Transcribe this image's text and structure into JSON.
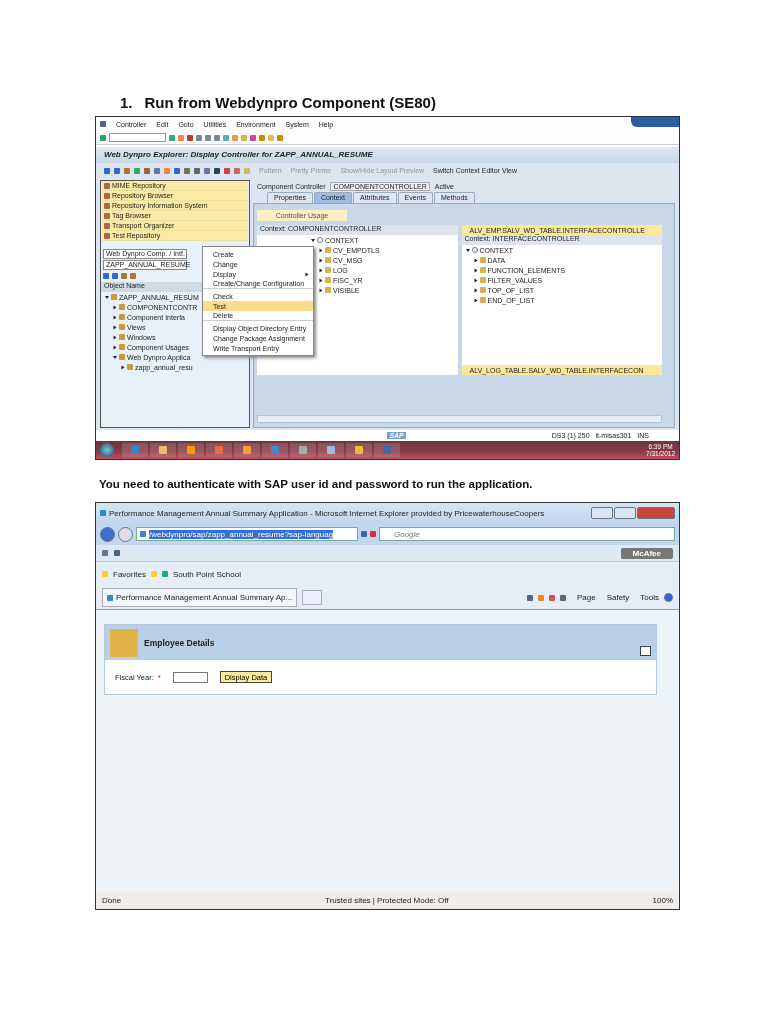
{
  "heading": {
    "number": "1.",
    "text": "Run from Webdynpro Component (SE80)"
  },
  "sap": {
    "menu": [
      "Controller",
      "Edit",
      "Goto",
      "Utilities",
      "Environment",
      "System",
      "Help"
    ],
    "title": "Web Dynpro Explorer: Display Controller for ZAPP_ANNUAL_RESUME",
    "app_toolbar": [
      "Pattern",
      "Pretty Printer",
      "Show/Hide Layout Preview",
      "Switch Context Editor View"
    ],
    "nav_items": [
      "MIME Repository",
      "Repository Browser",
      "Repository Information System",
      "Tag Browser",
      "Transport Organizer",
      "Test Repository"
    ],
    "object_type": "Web Dynpro Comp. / Intf.",
    "object_name": "ZAPP_ANNUAL_RESUME",
    "object_header": "Object Name",
    "tree": [
      {
        "label": "ZAPP_ANNUAL_RESUM",
        "expanded": true,
        "children": [
          {
            "label": "COMPONENTCONTR",
            "expanded": false
          },
          {
            "label": "Component Interfa",
            "expanded": false
          },
          {
            "label": "Views",
            "expanded": false
          },
          {
            "label": "Windows",
            "expanded": false
          },
          {
            "label": "Component Usages",
            "expanded": false
          },
          {
            "label": "Web Dynpro Applica",
            "expanded": true,
            "children": [
              {
                "label": "zapp_annual_resu",
                "expanded": false
              }
            ]
          }
        ]
      }
    ],
    "controller_label": "Component Controller",
    "controller_value": "COMPONENTCONTROLLER",
    "controller_status": "Active",
    "tabs": [
      {
        "label": "Properties",
        "selected": false
      },
      {
        "label": "Context",
        "selected": true
      },
      {
        "label": "Attributes",
        "selected": false
      },
      {
        "label": "Events",
        "selected": false
      },
      {
        "label": "Methods",
        "selected": false
      }
    ],
    "controller_usage": "Controller Usage",
    "left_context": {
      "header": "Context: COMPONENTCONTROLLER",
      "root": "CONTEXT",
      "nodes": [
        "CV_EMPDTLS",
        "CV_MSG",
        "LOG",
        "FISC_YR",
        "VISIBLE"
      ]
    },
    "right_context": {
      "usage_top": "ALV_EMP.SALV_WD_TABLE.INTERFACECONTROLLE",
      "header": "Context: INTERFACECONTROLLER",
      "root": "CONTEXT",
      "nodes": [
        "DATA",
        "FUNCTION_ELEMENTS",
        "FILTER_VALUES",
        "TOP_OF_LIST",
        "END_OF_LIST"
      ],
      "usage_bottom": "ALV_LOG_TABLE.SALV_WD_TABLE.INTERFACECON"
    },
    "context_menu": [
      {
        "label": "Create",
        "selected": false,
        "submenu": false,
        "separator_after": false
      },
      {
        "label": "Change",
        "selected": false,
        "submenu": false,
        "separator_after": false
      },
      {
        "label": "Display",
        "selected": false,
        "submenu": true,
        "separator_after": false
      },
      {
        "label": "Create/Change Configuration",
        "selected": false,
        "submenu": false,
        "separator_after": true
      },
      {
        "label": "Check",
        "selected": false,
        "submenu": false,
        "separator_after": false
      },
      {
        "label": "Test",
        "selected": true,
        "submenu": false,
        "separator_after": false
      },
      {
        "label": "Delete",
        "selected": false,
        "submenu": false,
        "separator_after": true
      },
      {
        "label": "Display Object Directory Entry",
        "selected": false,
        "submenu": false,
        "separator_after": false
      },
      {
        "label": "Change Package Assignment",
        "selected": false,
        "submenu": false,
        "separator_after": false
      },
      {
        "label": "Write Transport Entry",
        "selected": false,
        "submenu": false,
        "separator_after": false
      }
    ],
    "status": {
      "logo": "SAP",
      "session": "DS3 (1) 250",
      "server": "it-mlsas301",
      "mode": "INS"
    },
    "clock": {
      "time": "6:39 PM",
      "date": "7/31/2012"
    }
  },
  "paragraph": "You need to authenticate with SAP user id and password to run the application.",
  "ie": {
    "title": "Performance Management Annual Summary Application - Microsoft Internet Explorer provided by PricewaterhouseCoopers",
    "address": "/webdynpro/sap/zapp_annual_resume?sap-languag",
    "search_placeholder": "Google",
    "mcafee": "McAfee",
    "favorites": "Favorites",
    "favorite_link": "South Point School",
    "tab": "Performance Management Annual Summary Ap...",
    "commands": [
      "Page",
      "Safety",
      "Tools"
    ],
    "panel_title": "Employee Details",
    "field_label": "Fiscal Year:",
    "required": "*",
    "button": "Display Data",
    "status_text": "Done",
    "zone": "Trusted sites | Protected Mode: Off",
    "zoom": "100%"
  }
}
